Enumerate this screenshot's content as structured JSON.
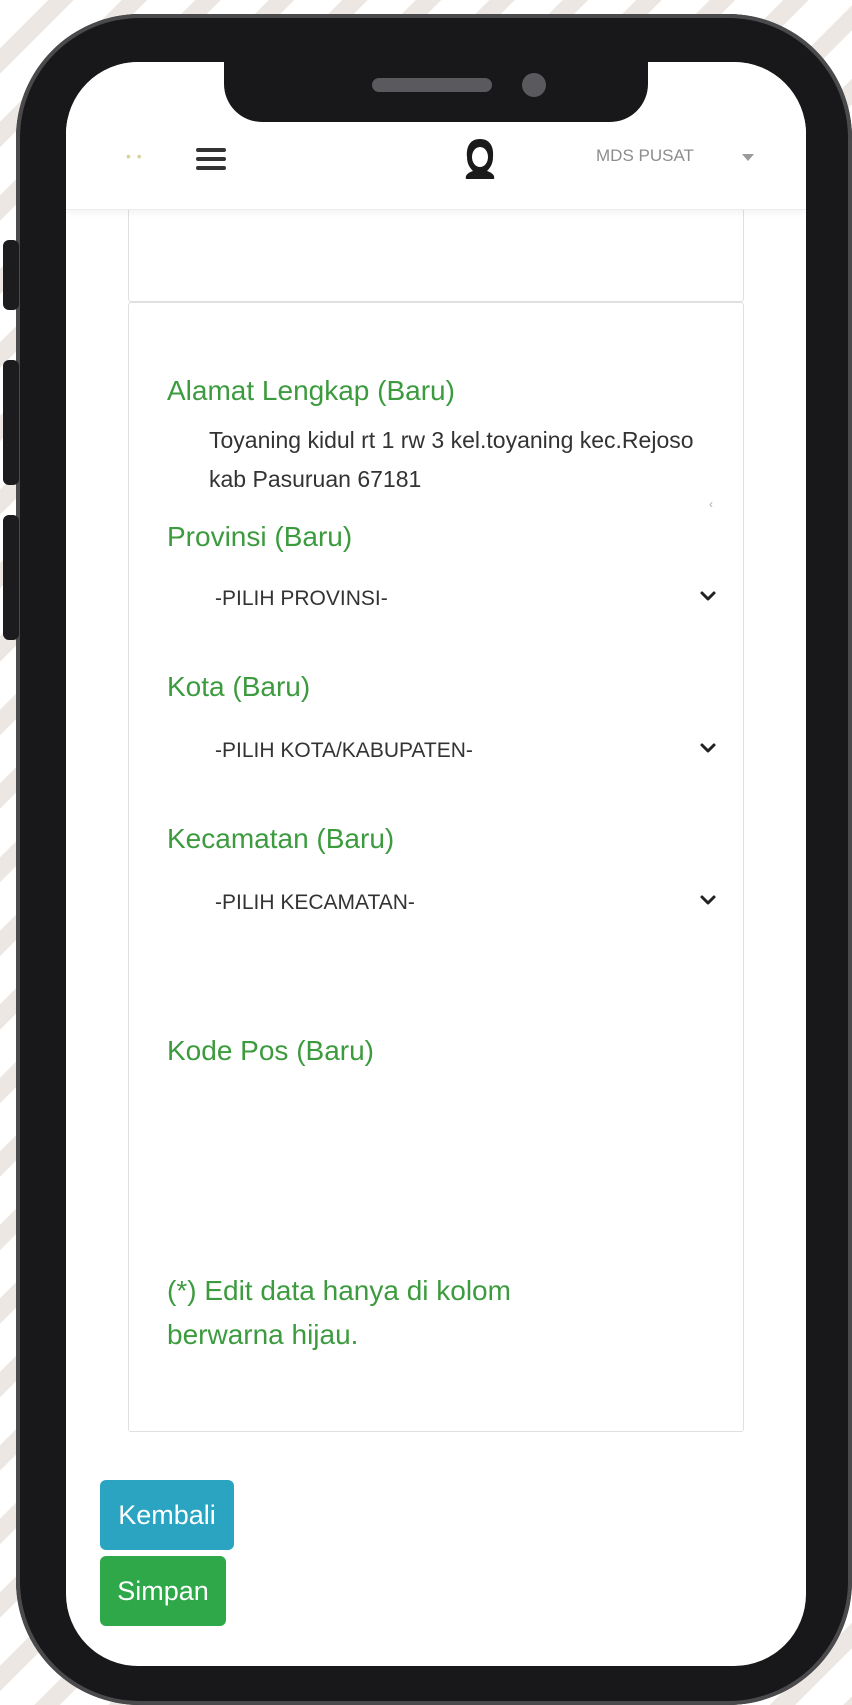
{
  "header": {
    "user_label": "MDS PUSAT"
  },
  "form": {
    "alamat": {
      "label": "Alamat Lengkap (Baru)",
      "value": "Toyaning kidul rt 1 rw 3 kel.toyaning kec.Rejoso kab Pasuruan 67181"
    },
    "provinsi": {
      "label": "Provinsi (Baru)",
      "selected": "-PILIH PROVINSI-"
    },
    "kota": {
      "label": "Kota (Baru)",
      "selected": "-PILIH KOTA/KABUPATEN-"
    },
    "kecamatan": {
      "label": "Kecamatan (Baru)",
      "selected": "-PILIH KECAMATAN-"
    },
    "kode_pos": {
      "label": "Kode Pos (Baru)",
      "value": ""
    },
    "note": "(*) Edit data hanya di kolom berwarna hijau."
  },
  "buttons": {
    "back_label": "Kembali",
    "save_label": "Simpan"
  },
  "icons": {
    "menu": "hamburger-icon",
    "avatar": "hijab-user-icon",
    "dropdown": "chevron-down-icon"
  },
  "colors": {
    "label_green": "#3c9b3e",
    "back_button": "#2ba4c2",
    "save_button": "#2fa84a"
  }
}
